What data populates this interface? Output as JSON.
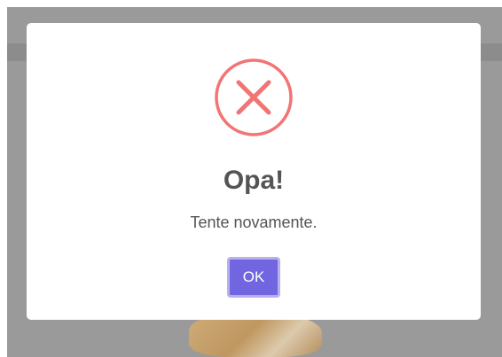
{
  "dialog": {
    "title": "Opa!",
    "message": "Tente novamente.",
    "confirm_label": "OK",
    "icon": "error-x-icon"
  },
  "colors": {
    "error_icon": "#f27474",
    "confirm_button": "#7166e0",
    "text": "#545454",
    "backdrop": "#9a9a9a"
  }
}
